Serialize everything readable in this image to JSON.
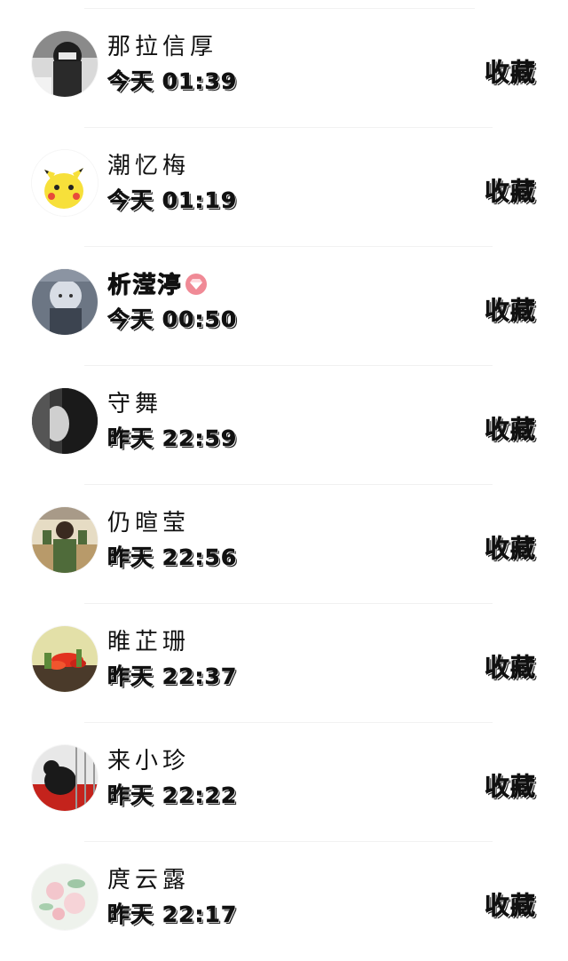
{
  "action_label": "收藏",
  "accent": {
    "badge": "#f08a96",
    "divider": "#f1f1f1",
    "text": "#111111"
  },
  "items": [
    {
      "name": "那拉信厚",
      "time": "今天 01:39",
      "avatar": "bw-portrait-avatar"
    },
    {
      "name": "潮忆梅",
      "time": "今天 01:19",
      "avatar": "pikachu-avatar"
    },
    {
      "name": "析滢渟",
      "time": "今天 00:50",
      "avatar": "anime-character-avatar",
      "badge": "diamond-icon"
    },
    {
      "name": "守舞",
      "time": "昨天 22:59",
      "avatar": "dark-hair-avatar"
    },
    {
      "name": "仍暄莹",
      "time": "昨天 22:56",
      "avatar": "person-photo-avatar"
    },
    {
      "name": "睢芷珊",
      "time": "昨天 22:37",
      "avatar": "red-flower-avatar"
    },
    {
      "name": "来小珍",
      "time": "昨天 22:22",
      "avatar": "black-dog-avatar"
    },
    {
      "name": "庹云露",
      "time": "昨天 22:17",
      "avatar": "floral-avatar"
    }
  ]
}
